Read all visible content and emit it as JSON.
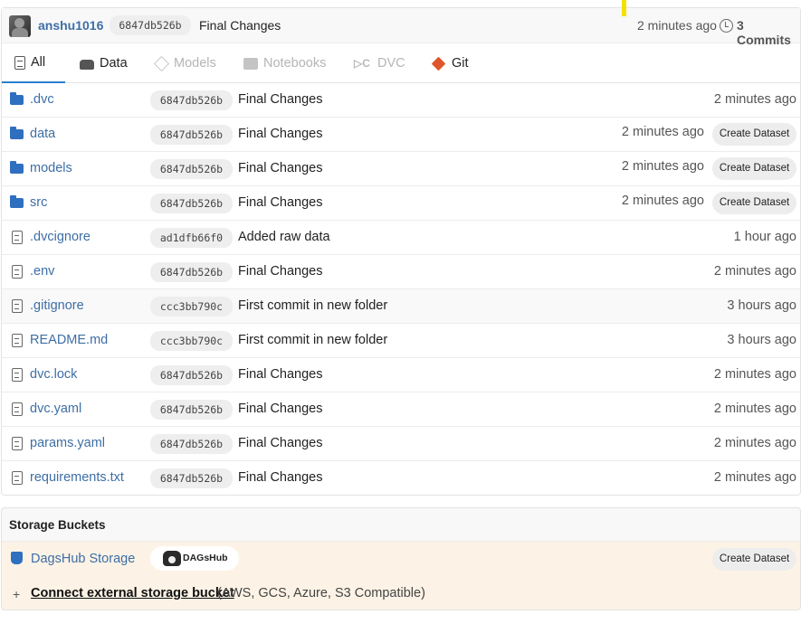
{
  "header": {
    "username": "anshu1016",
    "commit_sha": "6847db526b",
    "commit_message": "Final Changes",
    "time": "2 minutes ago",
    "commits": "3 Commits"
  },
  "tabs": [
    {
      "label": "All",
      "icon": "document-icon",
      "active": true
    },
    {
      "label": "Data",
      "icon": "data-icon",
      "active": false
    },
    {
      "label": "Models",
      "icon": "models-icon",
      "active": false,
      "disabled": true
    },
    {
      "label": "Notebooks",
      "icon": "notebook-icon",
      "active": false,
      "disabled": true
    },
    {
      "label": "DVC",
      "icon": "dvc-icon",
      "active": false,
      "disabled": true
    },
    {
      "label": "Git",
      "icon": "git-icon",
      "active": false
    }
  ],
  "files": [
    {
      "name": ".dvc",
      "type": "folder",
      "sha": "6847db526b",
      "message": "Final Changes",
      "time": "2 minutes ago",
      "action": ""
    },
    {
      "name": "data",
      "type": "folder",
      "sha": "6847db526b",
      "message": "Final Changes",
      "time": "2 minutes ago",
      "action": "Create Dataset"
    },
    {
      "name": "models",
      "type": "folder",
      "sha": "6847db526b",
      "message": "Final Changes",
      "time": "2 minutes ago",
      "action": "Create Dataset"
    },
    {
      "name": "src",
      "type": "folder",
      "sha": "6847db526b",
      "message": "Final Changes",
      "time": "2 minutes ago",
      "action": "Create Dataset"
    },
    {
      "name": ".dvcignore",
      "type": "file",
      "sha": "ad1dfb66f0",
      "message": "Added raw data",
      "time": "1 hour ago",
      "action": ""
    },
    {
      "name": ".env",
      "type": "file",
      "sha": "6847db526b",
      "message": "Final Changes",
      "time": "2 minutes ago",
      "action": ""
    },
    {
      "name": ".gitignore",
      "type": "file",
      "sha": "ccc3bb790c",
      "message": "First commit in new folder",
      "time": "3 hours ago",
      "action": ""
    },
    {
      "name": "README.md",
      "type": "file",
      "sha": "ccc3bb790c",
      "message": "First commit in new folder",
      "time": "3 hours ago",
      "action": ""
    },
    {
      "name": "dvc.lock",
      "type": "file",
      "sha": "6847db526b",
      "message": "Final Changes",
      "time": "2 minutes ago",
      "action": ""
    },
    {
      "name": "dvc.yaml",
      "type": "file",
      "sha": "6847db526b",
      "message": "Final Changes",
      "time": "2 minutes ago",
      "action": ""
    },
    {
      "name": "params.yaml",
      "type": "file",
      "sha": "6847db526b",
      "message": "Final Changes",
      "time": "2 minutes ago",
      "action": ""
    },
    {
      "name": "requirements.txt",
      "type": "file",
      "sha": "6847db526b",
      "message": "Final Changes",
      "time": "2 minutes ago",
      "action": ""
    }
  ],
  "storage": {
    "title": "Storage Buckets",
    "bucket_name": "DagsHub Storage",
    "logo_text": "DAGsHub",
    "create_label": "Create Dataset",
    "plus": "+",
    "connect_label": "Connect external storage bucket",
    "connect_note": "(AWS, GCS, Azure, S3 Compatible)"
  },
  "colors": {
    "link": "#3d6ea6",
    "folder": "#2f6fc0",
    "active_tab": "#2c7fcf",
    "git": "#e0562c",
    "storage_bg": "#fcf3e6"
  }
}
